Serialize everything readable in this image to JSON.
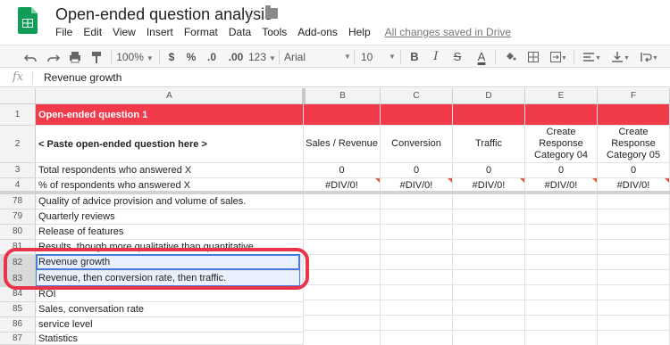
{
  "header": {
    "title": "Open-ended question analysis",
    "menu": [
      "File",
      "Edit",
      "View",
      "Insert",
      "Format",
      "Data",
      "Tools",
      "Add-ons",
      "Help"
    ],
    "save_status": "All changes saved in Drive"
  },
  "toolbar": {
    "zoom": "100%",
    "currency": "$",
    "percent": "%",
    "decrease_decimal": ".0",
    "increase_decimal": ".00",
    "more_formats": "123",
    "font": "Arial",
    "font_size": "10",
    "bold": "B",
    "italic": "I",
    "strike": "S",
    "text_color_label": "A"
  },
  "formula_bar": {
    "fx_label": "fx",
    "value": "Revenue growth"
  },
  "columns": [
    "A",
    "B",
    "C",
    "D",
    "E",
    "F"
  ],
  "rows": [
    {
      "num": "1",
      "a": "Open-ended question 1",
      "cells": [
        "",
        "",
        "",
        "",
        ""
      ]
    },
    {
      "num": "2",
      "a": "< Paste open-ended question here >",
      "cells": [
        "Sales / Revenue",
        "Conversion",
        "Traffic",
        "Create Response Category 04",
        "Create Response Category 05"
      ]
    },
    {
      "num": "3",
      "a": "Total respondents who answered X",
      "cells": [
        "0",
        "0",
        "0",
        "0",
        "0"
      ]
    },
    {
      "num": "4",
      "a": "% of respondents who answered X",
      "cells": [
        "#DIV/0!",
        "#DIV/0!",
        "#DIV/0!",
        "#DIV/0!",
        "#DIV/0!"
      ]
    },
    {
      "num": "78",
      "a": "Quality of advice provision and volume of sales."
    },
    {
      "num": "79",
      "a": "Quarterly reviews"
    },
    {
      "num": "80",
      "a": "Release of features"
    },
    {
      "num": "81",
      "a": "Results, though more qualitative than quantitative"
    },
    {
      "num": "82",
      "a": "Revenue growth"
    },
    {
      "num": "83",
      "a": "Revenue, then conversion rate, then traffic."
    },
    {
      "num": "84",
      "a": "ROI"
    },
    {
      "num": "85",
      "a": "Sales,  conversation rate"
    },
    {
      "num": "86",
      "a": "service level"
    },
    {
      "num": "87",
      "a": "Statistics"
    }
  ],
  "colors": {
    "header_red": "#f13a4a",
    "selection_blue": "#4a7bd9",
    "highlight_red": "#e8344a",
    "sheets_green": "#0f9d58"
  }
}
